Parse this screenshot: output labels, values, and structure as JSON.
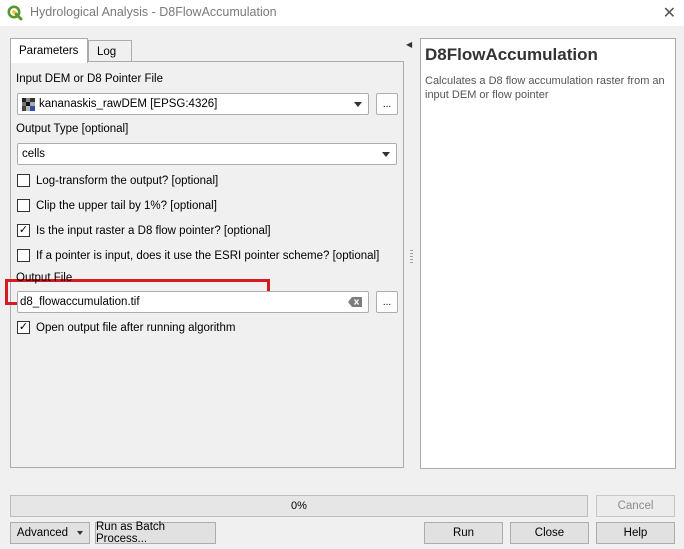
{
  "window": {
    "title": "Hydrological Analysis - D8FlowAccumulation",
    "close_glyph": "✕"
  },
  "tabs": [
    {
      "label": "Parameters",
      "active": true
    },
    {
      "label": "Log",
      "active": false
    }
  ],
  "params": {
    "input_label": "Input DEM or D8 Pointer File",
    "input_value": "kananaskis_rawDEM [EPSG:4326]",
    "input_browse": "...",
    "output_type_label": "Output Type [optional]",
    "output_type_value": "cells",
    "checkboxes": [
      {
        "label": "Log-transform the output? [optional]",
        "checked": false
      },
      {
        "label": "Clip the upper tail by 1%? [optional]",
        "checked": false
      },
      {
        "label": "Is the input raster a D8 flow pointer? [optional]",
        "checked": true
      },
      {
        "label": "If a pointer is input, does it use the ESRI pointer scheme? [optional]",
        "checked": false
      }
    ],
    "output_file_label": "Output File",
    "output_file_value": "d8_flowaccumulation.tif",
    "output_browse": "...",
    "open_output": {
      "label": "Open output file after running algorithm",
      "checked": true
    }
  },
  "help": {
    "title": "D8FlowAccumulation",
    "description": "Calculates a D8 flow accumulation raster from an input DEM or flow pointer"
  },
  "progress": {
    "value": 0,
    "text": "0%"
  },
  "buttons": {
    "cancel": "Cancel",
    "advanced": "Advanced",
    "batch": "Run as Batch Process...",
    "run": "Run",
    "close": "Close",
    "help": "Help"
  },
  "colors": {
    "highlight": "#d71920",
    "qgis_green": "#589632",
    "qgis_yellow": "#f0c419"
  },
  "icons": {
    "app": "qgis-logo-icon",
    "raster": "raster-layer-icon",
    "clear": "clear-text-icon"
  }
}
